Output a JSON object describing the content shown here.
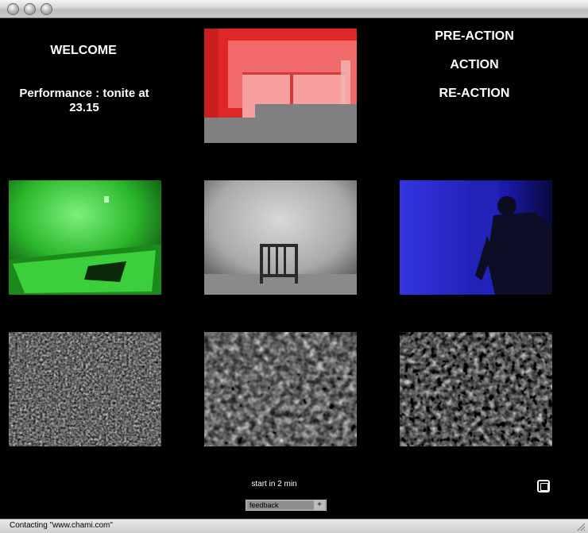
{
  "window": {
    "controls": [
      "close-button",
      "minimize-button",
      "zoom-button"
    ]
  },
  "left_panel": {
    "welcome": "WELCOME",
    "performance": "Performance : tonite at 23.15"
  },
  "right_menu": {
    "items": [
      "PRE-ACTION",
      "ACTION",
      "RE-ACTION"
    ]
  },
  "footer": {
    "start_text": "start in 2 min",
    "feedback_value": "feedback",
    "feedback_button": "+"
  },
  "status_bar": {
    "text": "Contacting \"www.chami.com\""
  },
  "colors": {
    "red_tint": "#e23a3a",
    "green_tint": "#22b022",
    "blue_tint": "#2b2bd8",
    "gray_block": "#808080"
  }
}
